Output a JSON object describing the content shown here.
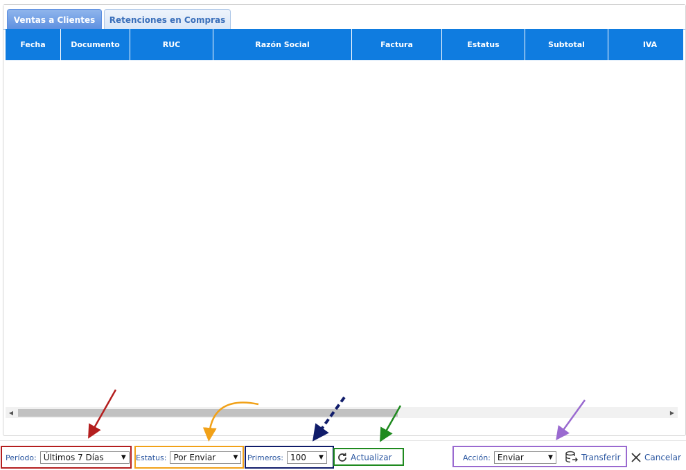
{
  "tabs": [
    {
      "label": "Ventas a Clientes",
      "active": true
    },
    {
      "label": "Retenciones en Compras",
      "active": false
    }
  ],
  "table": {
    "columns": [
      "Fecha",
      "Documento",
      "RUC",
      "Razón Social",
      "Factura",
      "Estatus",
      "Subtotal",
      "IVA"
    ],
    "rows": []
  },
  "toolbar": {
    "periodo": {
      "label": "Período:",
      "value": "Últimos 7 Días"
    },
    "estatus": {
      "label": "Estatus:",
      "value": "Por Enviar"
    },
    "primeros": {
      "label": "Primeros:",
      "value": "100"
    },
    "actualizar": "Actualizar",
    "accion": {
      "label": "Acción:",
      "value": "Enviar"
    },
    "transferir": "Transferir",
    "cancelar": "Cancelar"
  },
  "colors": {
    "header_blue": "#0f7ce0",
    "link_blue": "#2a56a0",
    "annotation_red": "#b41e1e",
    "annotation_orange": "#f1a118",
    "annotation_navy": "#101c6a",
    "annotation_green": "#1f8a1f",
    "annotation_purple": "#9a6ad0"
  },
  "icons": [
    "refresh-icon",
    "database-transfer-icon",
    "close-icon",
    "caret-down-icon",
    "arrow-left-icon",
    "arrow-right-icon"
  ]
}
